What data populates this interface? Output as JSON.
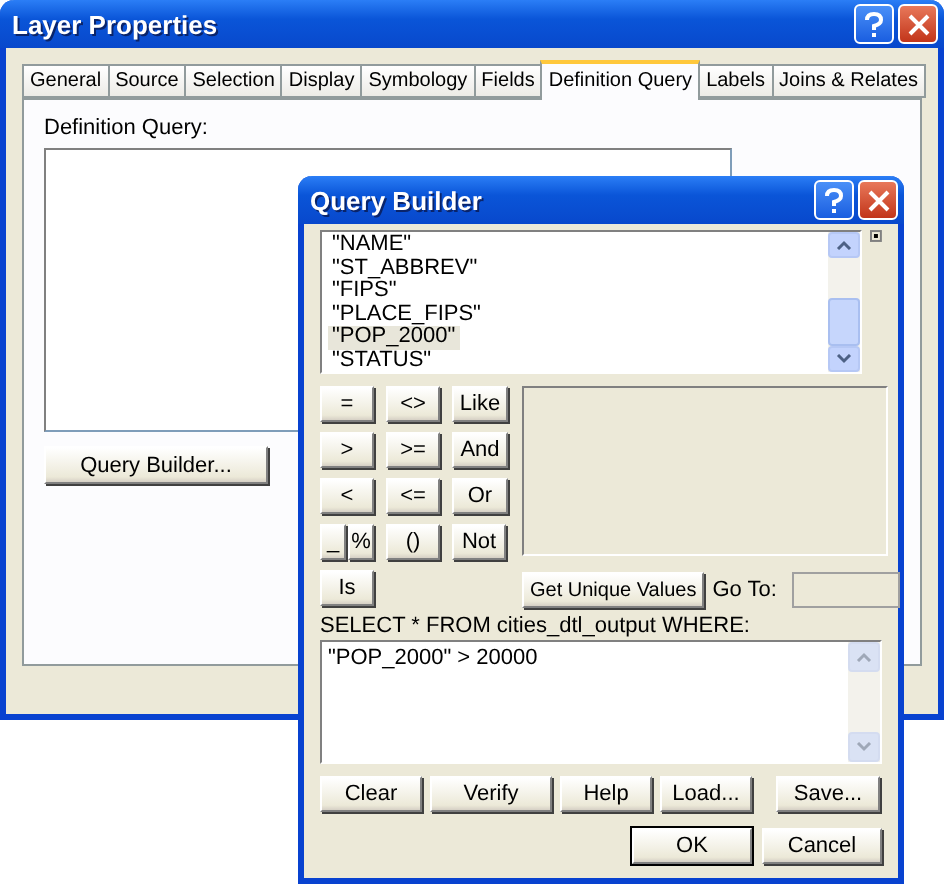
{
  "layer_properties": {
    "title": "Layer Properties",
    "tabs": [
      {
        "label": "General",
        "selected": false
      },
      {
        "label": "Source",
        "selected": false
      },
      {
        "label": "Selection",
        "selected": false
      },
      {
        "label": "Display",
        "selected": false
      },
      {
        "label": "Symbology",
        "selected": false
      },
      {
        "label": "Fields",
        "selected": false
      },
      {
        "label": "Definition Query",
        "selected": true
      },
      {
        "label": "Labels",
        "selected": false
      },
      {
        "label": "Joins & Relates",
        "selected": false
      }
    ],
    "definition_label": "Definition Query:",
    "query_builder_button": "Query Builder..."
  },
  "query_builder": {
    "title": "Query Builder",
    "fields": [
      {
        "label": "\"NAME\"",
        "selected": false
      },
      {
        "label": "\"ST_ABBREV\"",
        "selected": false
      },
      {
        "label": "\"FIPS\"",
        "selected": false
      },
      {
        "label": "\"PLACE_FIPS\"",
        "selected": false
      },
      {
        "label": "\"POP_2000\"",
        "selected": true
      },
      {
        "label": "\"STATUS\"",
        "selected": false
      }
    ],
    "operators": [
      [
        "=",
        "<>",
        "Like"
      ],
      [
        ">",
        ">=",
        "And"
      ],
      [
        "<",
        "<=",
        "Or"
      ],
      [
        "_",
        "%",
        "()",
        "Not"
      ],
      [
        "Is"
      ]
    ],
    "unique_values_button": "Get Unique Values",
    "goto_label": "Go To:",
    "sql_label": "SELECT * FROM cities_dtl_output WHERE:",
    "expression": "\"POP_2000\" > 20000",
    "action_buttons": [
      "Clear",
      "Verify",
      "Help",
      "Load...",
      "Save..."
    ],
    "dialog_buttons": [
      "OK",
      "Cancel"
    ]
  }
}
